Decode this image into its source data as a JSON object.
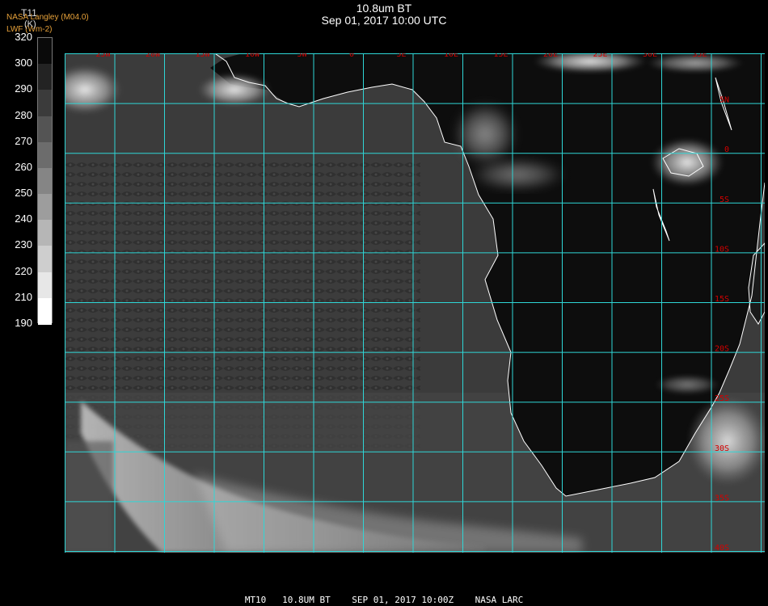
{
  "header": {
    "title": "10.8um BT",
    "datetime": "Sep 01, 2017 10:00 UTC"
  },
  "source": {
    "line1": "NASA Langley (M04.0)",
    "line2": "LWF (Wm-2)"
  },
  "colorbar": {
    "variable": "T11",
    "unit": "(K)",
    "ticks": [
      "320",
      "300",
      "290",
      "280",
      "270",
      "260",
      "250",
      "240",
      "230",
      "220",
      "210",
      "190"
    ]
  },
  "map": {
    "lon_labels": [
      "25W",
      "20W",
      "15W",
      "10W",
      "5W",
      "0",
      "5E",
      "10E",
      "15E",
      "20E",
      "25E",
      "30E",
      "35E"
    ],
    "lat_labels": [
      "5N",
      "0",
      "5S",
      "10S",
      "15S",
      "20S",
      "25S",
      "30S",
      "35S",
      "40S"
    ],
    "colors": {
      "grid": "#2fd6d6",
      "coast": "#ffffff",
      "label": "#d40000",
      "ocean": "#3a3a3a",
      "land": "#0c0c0c"
    }
  },
  "footer": {
    "text": "MT10   10.8UM BT    SEP 01, 2017 10:00Z    NASA LARC"
  }
}
